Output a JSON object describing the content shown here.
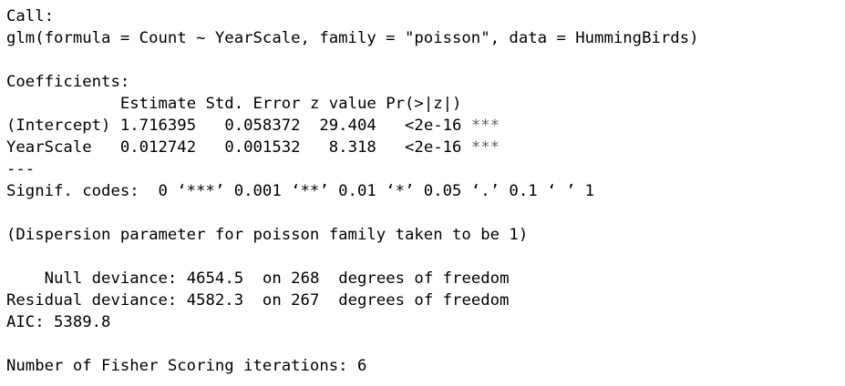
{
  "output": {
    "call_header": "Call:",
    "call": "glm(formula = Count ~ YearScale, family = \"poisson\", data = HummingBirds)",
    "coef_header": "Coefficients:",
    "coef_table": {
      "columns": [
        "Estimate",
        "Std. Error",
        "z value",
        "Pr(>|z|)"
      ],
      "rows": [
        {
          "term": "(Intercept)",
          "estimate": "1.716395",
          "std_error": "0.058372",
          "z_value": "29.404",
          "p_value": "<2e-16",
          "signif": "***"
        },
        {
          "term": "YearScale",
          "estimate": "0.012742",
          "std_error": "0.001532",
          "z_value": "8.318",
          "p_value": "<2e-16",
          "signif": "***"
        }
      ]
    },
    "separator": "---",
    "signif_codes": "Signif. codes:  0 ‘***’ 0.001 ‘**’ 0.01 ‘*’ 0.05 ‘.’ 0.1 ‘ ’ 1",
    "dispersion": "(Dispersion parameter for poisson family taken to be 1)",
    "null_deviance": {
      "label": "Null deviance:",
      "value": "4654.5",
      "df": "268",
      "df_text": "degrees of freedom"
    },
    "residual_deviance": {
      "label": "Residual deviance:",
      "value": "4582.3",
      "df": "267",
      "df_text": "degrees of freedom"
    },
    "aic": {
      "label": "AIC:",
      "value": "5389.8"
    },
    "fisher": {
      "label": "Number of Fisher Scoring iterations:",
      "value": "6"
    }
  }
}
